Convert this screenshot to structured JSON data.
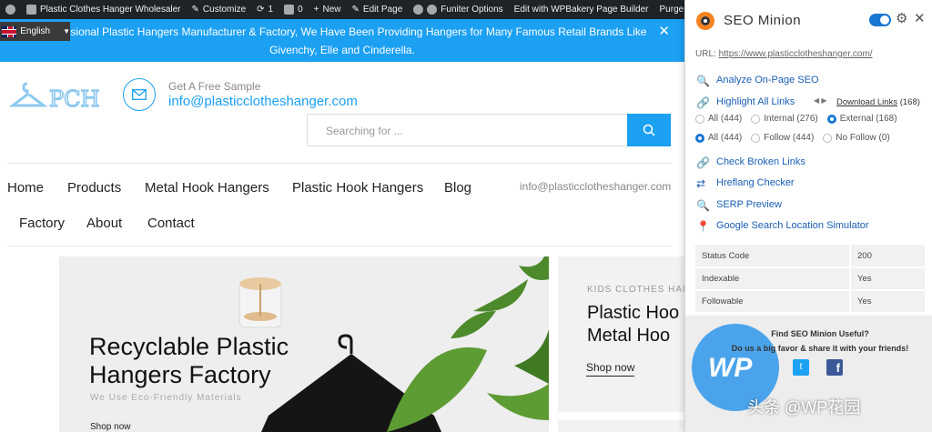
{
  "admin_bar": {
    "site_name": "Plastic Clothes Hanger Wholesaler",
    "customize": "Customize",
    "updates_count": "1",
    "comments_count": "0",
    "new": "New",
    "edit_page": "Edit Page",
    "funiter_options": "Funiter Options",
    "wpbakery": "Edit with WPBakery Page Builder",
    "purge_cache": "Purge SG Cache"
  },
  "banner": {
    "line1": "fessional Plastic Hangers Manufacturer & Factory, We Have Been Providing Hangers for Many Famous Retail Brands Like",
    "line2": "Givenchy, Elle and Cinderella.",
    "close": "✕"
  },
  "language": {
    "label": "English"
  },
  "header": {
    "logo_text": "PCH",
    "sample_label": "Get A Free Sample",
    "sample_email": "info@plasticclotheshanger.com",
    "search_placeholder": "Searching for ..."
  },
  "nav": {
    "items": [
      "Home",
      "Products",
      "Metal Hook Hangers",
      "Plastic Hook Hangers",
      "Blog",
      "Factory",
      "About",
      "Contact"
    ],
    "email": "info@plasticclotheshanger.com"
  },
  "hero": {
    "title_line1": "Recyclable Plastic",
    "title_line2": "Hangers Factory",
    "subtitle": "We Use Eco-Friendly Materials",
    "cta": "Shop now"
  },
  "card2": {
    "eyebrow": "KIDS CLOTHES HAN",
    "title_line1": "Plastic Hoo",
    "title_line2": "Metal Hoo",
    "cta": "Shop now"
  },
  "seo_panel": {
    "title": "SEO Minion",
    "url_label": "URL:",
    "url": "https://www.plasticclotheshanger.com/",
    "analyze": "Analyze On-Page SEO",
    "highlight": "Highlight All Links",
    "download": "Download Links",
    "download_count": "(168)",
    "filter_row1": [
      "All (444)",
      "Internal (276)",
      "External (168)"
    ],
    "filter_row2": [
      "All (444)",
      "Follow (444)",
      "No Follow (0)"
    ],
    "broken": "Check Broken Links",
    "hreflang": "Hreflang Checker",
    "serp": "SERP Preview",
    "location": "Google Search Location Simulator",
    "status": [
      {
        "label": "Status Code",
        "value": "200"
      },
      {
        "label": "Indexable",
        "value": "Yes"
      },
      {
        "label": "Followable",
        "value": "Yes"
      }
    ],
    "promo_q1": "Find SEO Minion Useful?",
    "promo_q2": "Do us a big favor & share it with your friends!"
  },
  "watermark": {
    "logo": "WP",
    "text": "头条 @WP花园"
  },
  "colors": {
    "accent": "#1ba0f2",
    "panel_link": "#1a5fb4",
    "admin_bar": "#1d2327"
  }
}
